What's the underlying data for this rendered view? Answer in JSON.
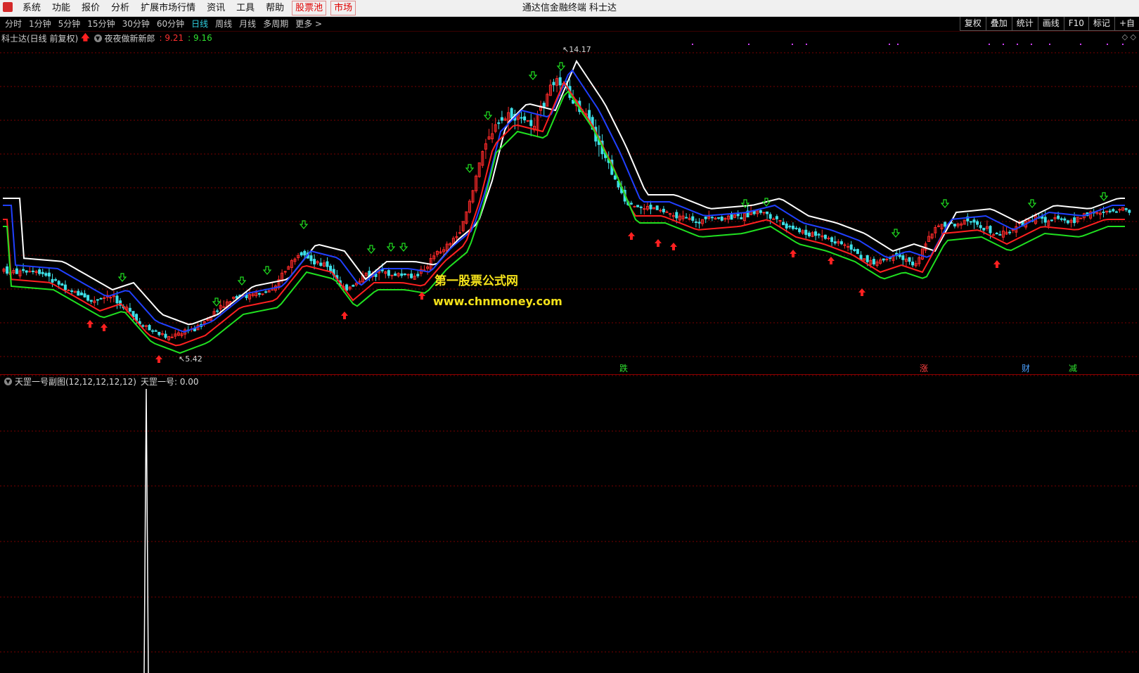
{
  "window": {
    "title": "通达信金融终端 科士达"
  },
  "menu": [
    "系统",
    "功能",
    "报价",
    "分析",
    "扩展市场行情",
    "资讯",
    "工具",
    "帮助"
  ],
  "menu_red": [
    "股票池",
    "市场"
  ],
  "periods": [
    "分时",
    "1分钟",
    "5分钟",
    "15分钟",
    "30分钟",
    "60分钟",
    "日线",
    "周线",
    "月线",
    "多周期",
    "更多 >"
  ],
  "active_period": "日线",
  "tools": [
    "复权",
    "叠加",
    "统计",
    "画线",
    "F10",
    "标记",
    "+自"
  ],
  "main_chart": {
    "title": "科士达(日线 前复权)",
    "indicator_name": "夜夜做新新郎",
    "value_red": ": 9.21",
    "value_green": ": 9.16",
    "high_label": "14.17",
    "low_label": "5.42",
    "watermark_title": "第一股票公式网",
    "watermark_url": "www.chnmoney.com",
    "events": [
      {
        "text": "跌",
        "color": "#30e030"
      },
      {
        "text": "涨",
        "color": "#ff4040"
      },
      {
        "text": "财",
        "color": "#4aa0ff"
      },
      {
        "text": "减",
        "color": "#30e030"
      }
    ]
  },
  "sub_chart": {
    "title": "天罡一号副图(12,12,12,12,12)",
    "value_label": "天罡一号: 0.00"
  },
  "colors": {
    "grid": "#7a0000",
    "up_candle": "#ff2a2a",
    "down_candle": "#3ee0e8",
    "ma_white": "#ffffff",
    "ma_blue": "#2040ff",
    "ma_red": "#ff2020",
    "ma_green": "#20e020",
    "buy_arrow": "#ff2020",
    "sell_arrow": "#20e020"
  }
}
